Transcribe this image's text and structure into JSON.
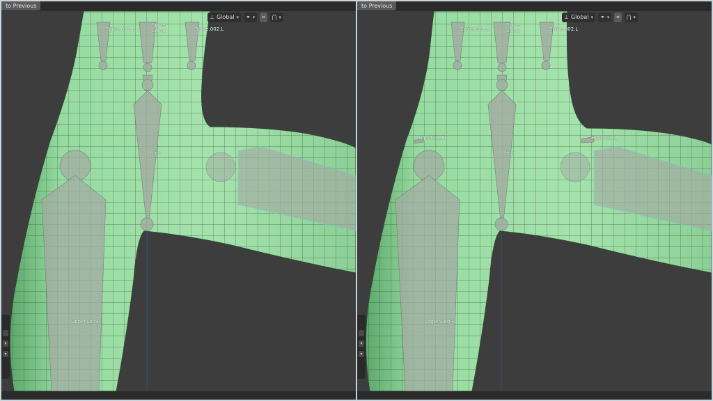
{
  "back_button": "to Previous",
  "toolbar": {
    "transform_orientation": "Global",
    "icons": [
      "axes-icon",
      "pivot-icon",
      "snap-icon",
      "proportional-icon"
    ]
  },
  "left_viewport": {
    "labels": {
      "spine_r": "Spine.002.R",
      "spine_c_top": "Spine",
      "spine_c_sub": "Spine",
      "spine_l": "Spine.002.L",
      "hips": "Hips",
      "upper_leg_r": "Upper.Leg.R"
    }
  },
  "right_viewport": {
    "labels": {
      "spine_r": "Spine.002.R",
      "spine_c_top": "Spine",
      "spine_c_sub": "Spine",
      "spine_l": "Spine.002.L",
      "hips": "Hips",
      "hips_r": "Hips.001.R",
      "hips_l": "Hips.001.L",
      "upper_leg_r": "Upper.Leg.R"
    }
  },
  "colors": {
    "mesh_fill": "#97dba0",
    "mesh_shadow": "#5da86a",
    "wire": "#2d4a33",
    "bone_fill": "#a3aba3",
    "viewport_bg": "#3d3d3d"
  }
}
